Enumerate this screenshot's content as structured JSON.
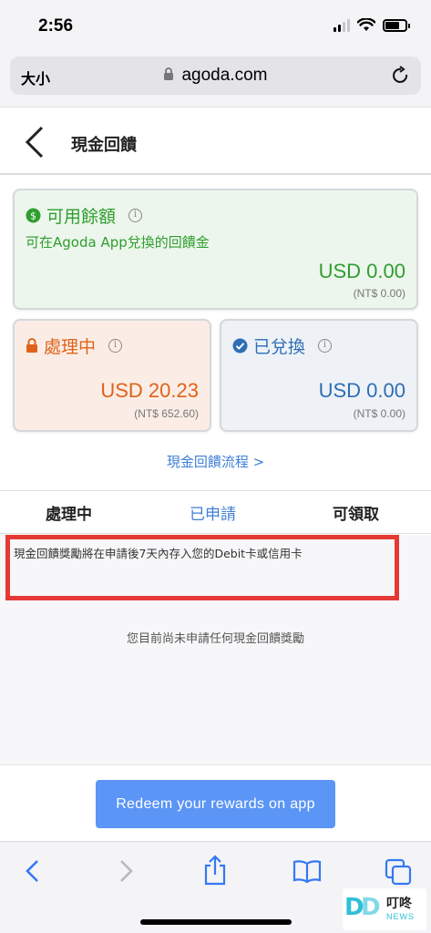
{
  "status_bar": {
    "time": "2:56"
  },
  "browser": {
    "text_size_label": "大小",
    "url": "agoda.com"
  },
  "header": {
    "title": "現金回饋"
  },
  "cards": {
    "available": {
      "title": "可用餘額",
      "subtitle": "可在Agoda App兌換的回饋金",
      "amount": "USD 0.00",
      "amount_local": "(NT$ 0.00)",
      "color": "#2f9e2f"
    },
    "processing": {
      "title": "處理中",
      "amount": "USD 20.23",
      "amount_local": "(NT$ 652.60)",
      "color": "#e0621a"
    },
    "redeemed": {
      "title": "已兌換",
      "amount": "USD 0.00",
      "amount_local": "(NT$ 0.00)",
      "color": "#2f6db5"
    }
  },
  "flow_link": "現金回饋流程 >",
  "tabs": [
    {
      "label": "處理中"
    },
    {
      "label": "已申請",
      "active": true
    },
    {
      "label": "可領取"
    }
  ],
  "content": {
    "notice": "現金回饋獎勵將在申請後7天內存入您的Debit卡或信用卡",
    "empty_message": "您目前尚未申請任何現金回饋獎勵"
  },
  "footer": {
    "button_label": "Redeem your rewards on app"
  },
  "toolbar": {
    "icons": [
      "back-icon",
      "forward-icon",
      "share-icon",
      "bookmarks-icon",
      "tabs-icon"
    ]
  },
  "watermark": {
    "name": "叮咚",
    "sub": "NEWS"
  },
  "colors": {
    "accent": "#3f7fd4",
    "button": "#5b95f5",
    "highlight": "#e53935"
  }
}
